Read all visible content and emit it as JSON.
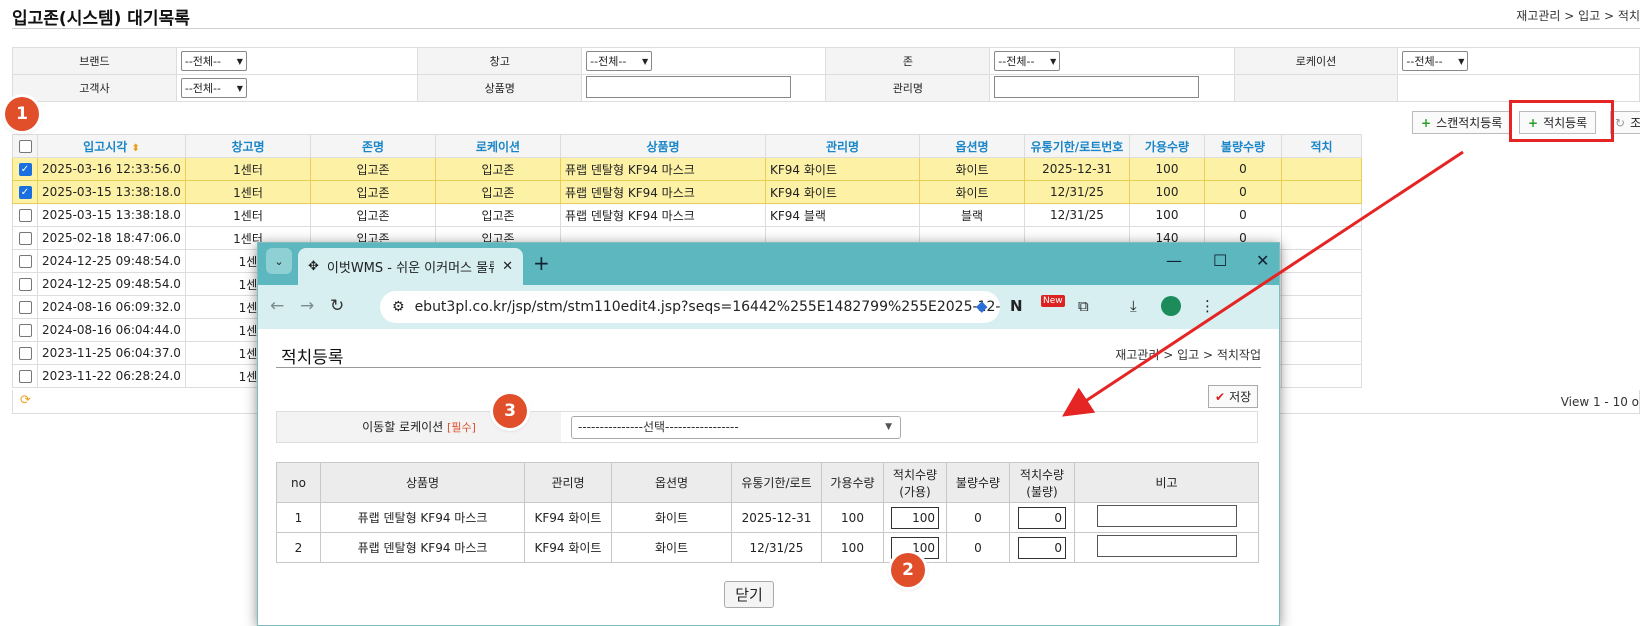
{
  "header": {
    "title": "입고존(시스템) 대기목록",
    "breadcrumb": "재고관리 > 입고 > 적치"
  },
  "search": {
    "brand_label": "브랜드",
    "brand_value": "--전체--",
    "warehouse_label": "창고",
    "warehouse_value": "--전체--",
    "zone_label": "존",
    "zone_value": "--전체--",
    "location_label": "로케이션",
    "location_value": "--전체--",
    "customer_label": "고객사",
    "customer_value": "--전체--",
    "product_label": "상품명",
    "mgmt_label": "관리명"
  },
  "toolbar": {
    "scan_putaway": "스캔적치등록",
    "putaway": "적치등록",
    "third": "조"
  },
  "grid": {
    "columns": [
      "입고시각",
      "창고명",
      "존명",
      "로케이션",
      "상품명",
      "관리명",
      "옵션명",
      "유통기한/로트번호",
      "가용수량",
      "불량수량",
      "적치"
    ],
    "rows": [
      {
        "checked": true,
        "time": "2025-03-16 12:33:56.0",
        "wh": "1센터",
        "zone": "입고존",
        "loc": "입고존",
        "product": "퓨랩 덴탈형 KF94 마스크",
        "mgmt": "KF94 화이트",
        "opt": "화이트",
        "lot": "2025-12-31",
        "avail": "100",
        "bad": "0"
      },
      {
        "checked": true,
        "time": "2025-03-15 13:38:18.0",
        "wh": "1센터",
        "zone": "입고존",
        "loc": "입고존",
        "product": "퓨랩 덴탈형 KF94 마스크",
        "mgmt": "KF94 화이트",
        "opt": "화이트",
        "lot": "12/31/25",
        "avail": "100",
        "bad": "0"
      },
      {
        "checked": false,
        "time": "2025-03-15 13:38:18.0",
        "wh": "1센터",
        "zone": "입고존",
        "loc": "입고존",
        "product": "퓨랩 덴탈형 KF94 마스크",
        "mgmt": "KF94 블랙",
        "opt": "블랙",
        "lot": "12/31/25",
        "avail": "100",
        "bad": "0"
      },
      {
        "checked": false,
        "time": "2025-02-18 18:47:06.0",
        "wh": "1센터",
        "zone": "입고존",
        "loc": "입고존",
        "product": "",
        "mgmt": "",
        "opt": "",
        "lot": "",
        "avail": "140",
        "bad": "0"
      },
      {
        "checked": false,
        "time": "2024-12-25 09:48:54.0",
        "wh": "1센",
        "zone": "",
        "loc": "",
        "product": "",
        "mgmt": "",
        "opt": "",
        "lot": "",
        "avail": "",
        "bad": ""
      },
      {
        "checked": false,
        "time": "2024-12-25 09:48:54.0",
        "wh": "1센",
        "zone": "",
        "loc": "",
        "product": "",
        "mgmt": "",
        "opt": "",
        "lot": "",
        "avail": "",
        "bad": ""
      },
      {
        "checked": false,
        "time": "2024-08-16 06:09:32.0",
        "wh": "1센",
        "zone": "",
        "loc": "",
        "product": "",
        "mgmt": "",
        "opt": "",
        "lot": "",
        "avail": "",
        "bad": ""
      },
      {
        "checked": false,
        "time": "2024-08-16 06:04:44.0",
        "wh": "1센",
        "zone": "",
        "loc": "",
        "product": "",
        "mgmt": "",
        "opt": "",
        "lot": "",
        "avail": "",
        "bad": ""
      },
      {
        "checked": false,
        "time": "2023-11-25 06:04:37.0",
        "wh": "1센",
        "zone": "",
        "loc": "",
        "product": "",
        "mgmt": "",
        "opt": "",
        "lot": "",
        "avail": "",
        "bad": ""
      },
      {
        "checked": false,
        "time": "2023-11-22 06:28:24.0",
        "wh": "1센",
        "zone": "",
        "loc": "",
        "product": "",
        "mgmt": "",
        "opt": "",
        "lot": "",
        "avail": "",
        "bad": ""
      }
    ],
    "view_text": "View 1 - 10 o"
  },
  "badges": {
    "b1": "1",
    "b2": "2",
    "b3": "3"
  },
  "popup": {
    "tab_title": "이벗WMS - 쉬운 이커머스 물류",
    "url": "ebut3pl.co.kr/jsp/stm/stm110edit4.jsp?seqs=16442%255E1482799%255E2025-12-3...",
    "ext_badge": "New",
    "page_title": "적치등록",
    "breadcrumb": "재고관리 > 입고 > 적치작업",
    "save": "저장",
    "loc_label": "이동할 로케이션",
    "loc_required": "[필수]",
    "loc_select": "---------------선택-----------------",
    "columns": [
      "no",
      "상품명",
      "관리명",
      "옵션명",
      "유통기한/로트",
      "가용수량",
      "적치수량\n(가용)",
      "불량수량",
      "적치수량\n(불량)",
      "비고"
    ],
    "rows": [
      {
        "no": "1",
        "product": "퓨랩 덴탈형 KF94 마스크",
        "mgmt": "KF94 화이트",
        "opt": "화이트",
        "lot": "2025-12-31",
        "avail": "100",
        "put_avail": "100",
        "bad": "0",
        "put_bad": "0"
      },
      {
        "no": "2",
        "product": "퓨랩 덴탈형 KF94 마스크",
        "mgmt": "KF94 화이트",
        "opt": "화이트",
        "lot": "12/31/25",
        "avail": "100",
        "put_avail": "100",
        "bad": "0",
        "put_bad": "0"
      }
    ],
    "close": "닫기"
  }
}
